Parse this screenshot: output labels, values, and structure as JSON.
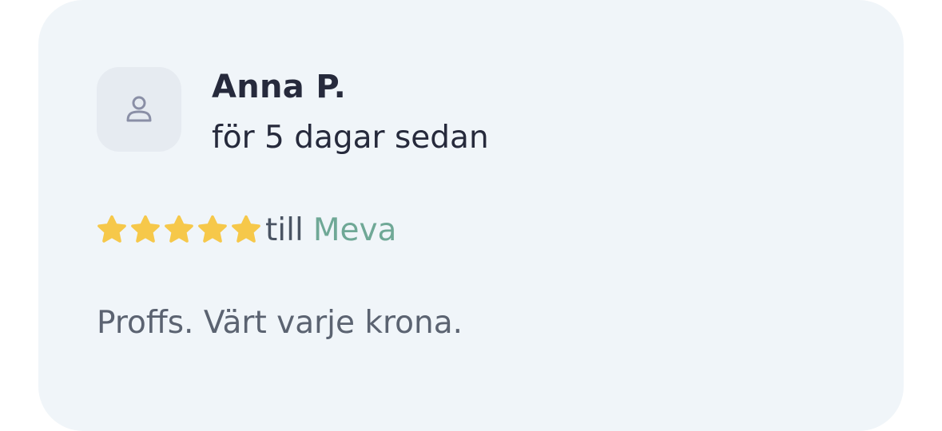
{
  "review": {
    "author": "Anna P.",
    "time": "för 5 dagar sedan",
    "rating": 5,
    "rating_max": 5,
    "to_text": "till",
    "company": "Meva",
    "text": "Proffs. Värt varje krona."
  },
  "icons": {
    "avatar": "user-icon",
    "star": "star-icon"
  },
  "colors": {
    "card_background": "#f0f5f9",
    "star": "#f6c84a",
    "company_link": "#6fa896",
    "author_text": "#262a3c"
  }
}
